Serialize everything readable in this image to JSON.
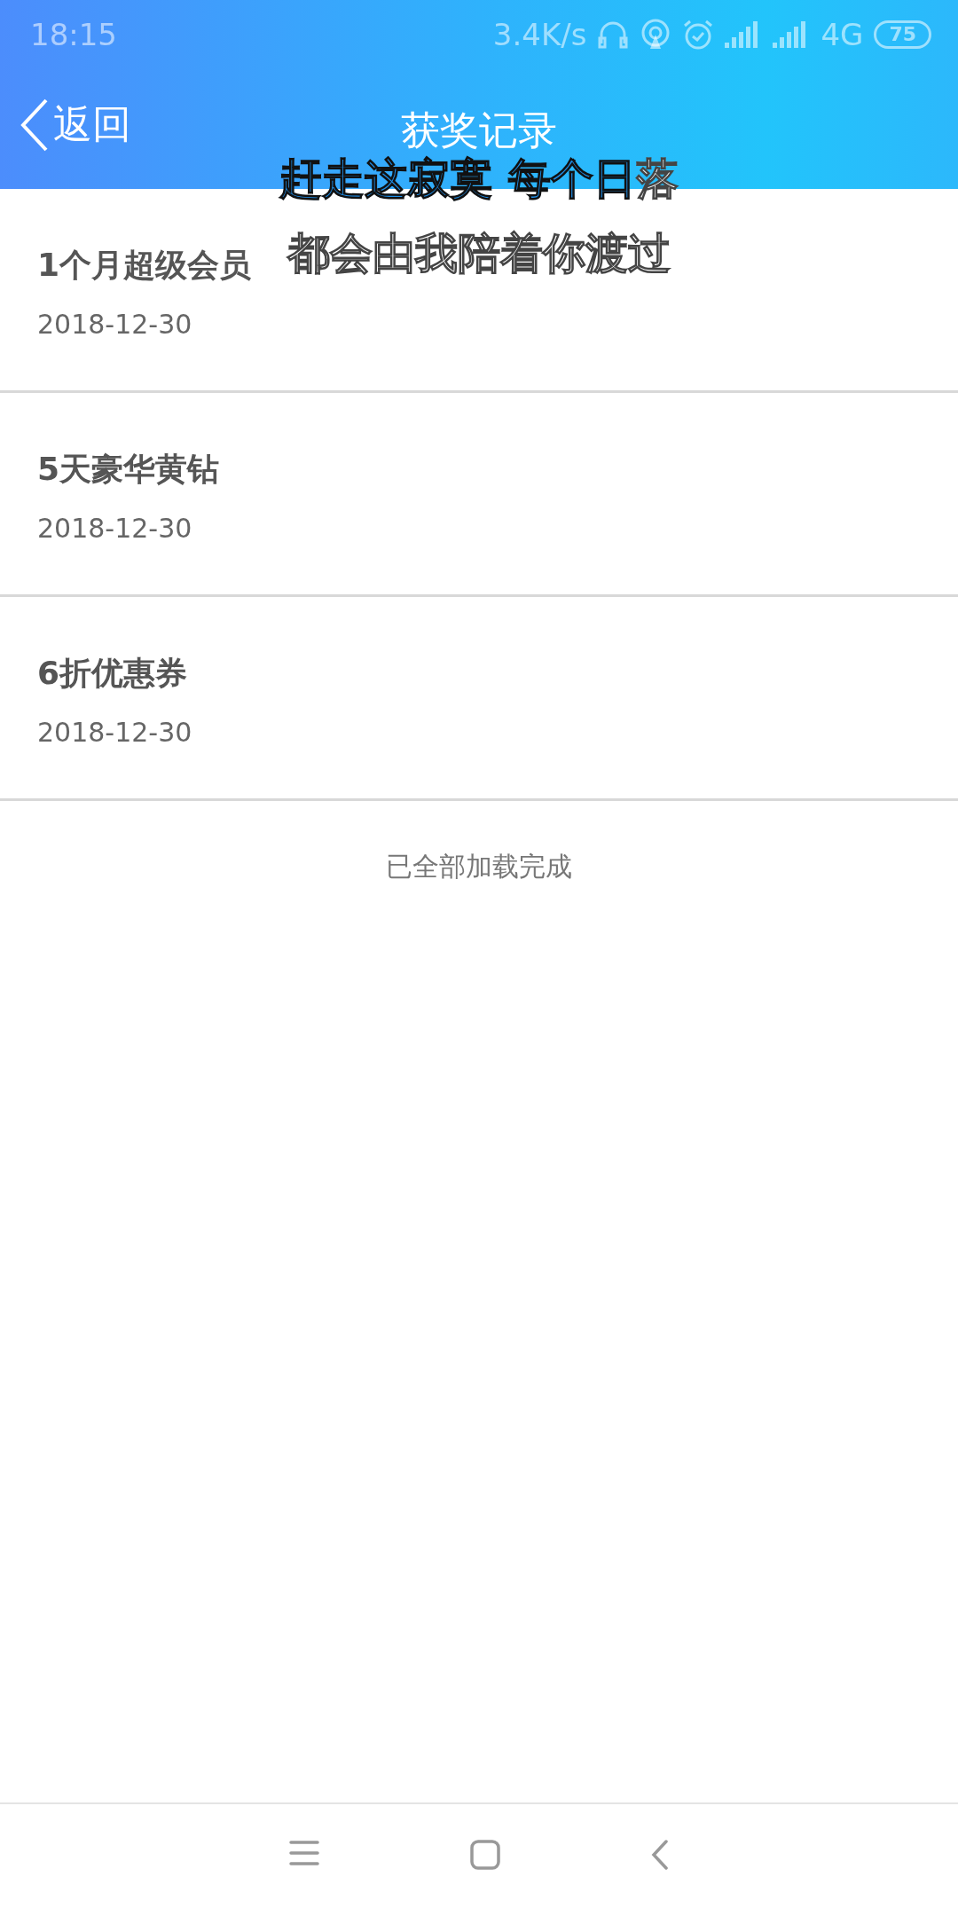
{
  "status_bar": {
    "time": "18:15",
    "speed": "3.4K/s",
    "network": "4G",
    "battery": "75"
  },
  "header": {
    "back": "返回",
    "title": "获奖记录"
  },
  "records": [
    {
      "name": "1个月超级会员",
      "date": "2018-12-30"
    },
    {
      "name": "5天豪华黄钻",
      "date": "2018-12-30"
    },
    {
      "name": "6折优惠券",
      "date": "2018-12-30"
    }
  ],
  "footer": "已全部加载完成",
  "lyrics": [
    [
      {
        "text": "赶走这寂寞",
        "sung": true
      },
      {
        "text": "每个日",
        "sung": true
      },
      {
        "text": "落",
        "sung": false
      }
    ],
    [
      {
        "text": "都会由我陪着你渡过",
        "sung": false
      }
    ]
  ]
}
